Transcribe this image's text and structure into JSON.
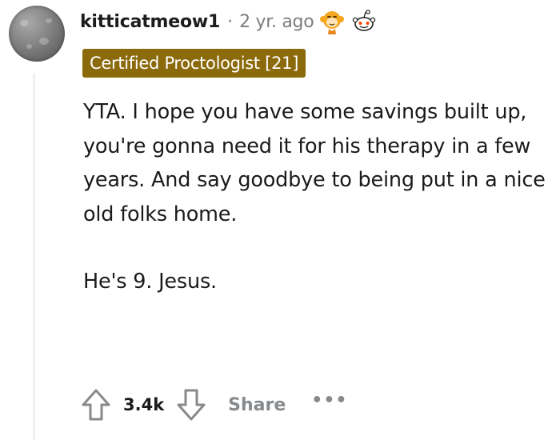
{
  "comment": {
    "username": "kitticatmeow1",
    "separator": "·",
    "age": "2 yr. ago",
    "awards": [
      "monkey-award-icon",
      "reddit-alien-award-icon"
    ],
    "flair": "Certified Proctologist [21]",
    "paragraphs": [
      "YTA. I hope you have some savings built up, you're gonna need it for his therapy in a few years. And say goodbye to being put in a nice old folks home.",
      "He's 9. Jesus."
    ],
    "score": "3.4k",
    "share_label": "Share",
    "more_label": "•••"
  },
  "colors": {
    "flair_bg": "#8b6a0b",
    "flair_text": "#ffffff",
    "meta_gray": "#7c7c7c",
    "action_gray": "#878a8c",
    "thread_line": "#edeff1"
  }
}
